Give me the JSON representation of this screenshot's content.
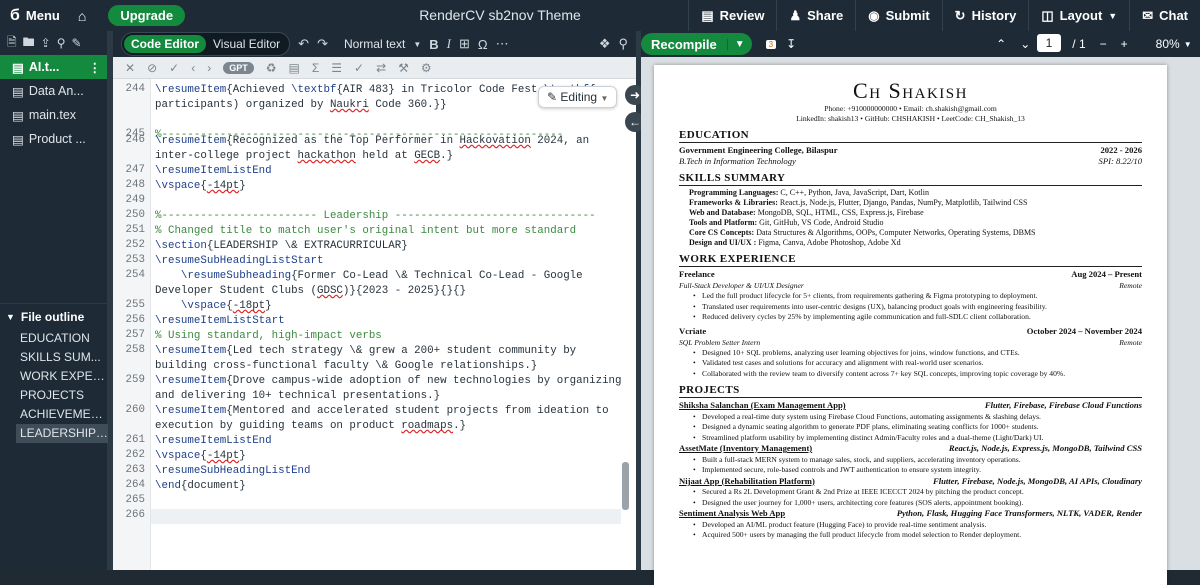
{
  "topbar": {
    "menu_label": "Menu",
    "upgrade_label": "Upgrade",
    "project_title": "RenderCV sb2nov Theme",
    "review_label": "Review",
    "share_label": "Share",
    "submit_label": "Submit",
    "history_label": "History",
    "layout_label": "Layout",
    "chat_label": "Chat"
  },
  "sidebar": {
    "files": [
      "AI.t...",
      "Data An...",
      "main.tex",
      "Product ..."
    ],
    "outline_title": "File outline",
    "outline": [
      "EDUCATION",
      "SKILLS SUM...",
      "WORK EXPER...",
      "PROJECTS",
      "ACHIEVEMEN...",
      "LEADERSHIP ..."
    ]
  },
  "editor": {
    "code_editor_label": "Code Editor",
    "visual_editor_label": "Visual Editor",
    "style_label": "Normal text",
    "gpt_label": "GPT",
    "editing_label": "Editing",
    "lines": [
      {
        "n": "244",
        "text": "\\resumeItem{Achieved \\textbf{AIR 483} in Tricolor Code Fest \\textbf{ participants) organized by Naukri Code 360.}}"
      },
      {
        "n": "245",
        "text": "%--------------------------------------------------------------"
      },
      {
        "n": "246",
        "text": "\\resumeItem{Recognized as the Top Performer in Hackovation 2024, an inter-college project hackathon held at GECB.}"
      },
      {
        "n": "247",
        "text": "\\resumeItemListEnd"
      },
      {
        "n": "248",
        "text": "\\vspace{-14pt}"
      },
      {
        "n": "249",
        "text": ""
      },
      {
        "n": "250",
        "text": "%------------------------ Leadership -------------------------------"
      },
      {
        "n": "251",
        "text": "% Changed title to match user's original intent but more standard"
      },
      {
        "n": "252",
        "text": "\\section{LEADERSHIP \\& EXTRACURRICULAR}"
      },
      {
        "n": "253",
        "text": "\\resumeSubHeadingListStart"
      },
      {
        "n": "254",
        "text": "    \\resumeSubheading{Former Co-Lead \\& Technical Co-Lead - Google Developer Student Clubs (GDSC)}{2023 - 2025}{}{}"
      },
      {
        "n": "255",
        "text": "    \\vspace{-18pt}"
      },
      {
        "n": "256",
        "text": "\\resumeItemListStart"
      },
      {
        "n": "257",
        "text": "% Using standard, high-impact verbs"
      },
      {
        "n": "258",
        "text": "\\resumeItem{Led tech strategy \\& grew a 200+ student community by building cross-functional faculty \\& Google relationships.}"
      },
      {
        "n": "259",
        "text": "\\resumeItem{Drove campus-wide adoption of new technologies by organizing and delivering 10+ technical presentations.}"
      },
      {
        "n": "260",
        "text": "\\resumeItem{Mentored and accelerated student projects from ideation to execution by guiding teams on product roadmaps.}"
      },
      {
        "n": "261",
        "text": "\\resumeItemListEnd"
      },
      {
        "n": "262",
        "text": "\\vspace{-14pt}"
      },
      {
        "n": "263",
        "text": "\\resumeSubHeadingListEnd"
      },
      {
        "n": "264",
        "text": "\\end{document}"
      },
      {
        "n": "265",
        "text": ""
      },
      {
        "n": "266",
        "text": ""
      }
    ]
  },
  "pdf": {
    "recompile_label": "Recompile",
    "page_current": "1",
    "page_total": "/ 1",
    "zoom": "80%",
    "name": "Ch Shakish",
    "contact1": "Phone: +910000000000 • Email: ch.shakish@gmail.com",
    "contact2": "LinkedIn: shakish13 • GitHub: CHSHAKISH • LeetCode: CH_Shakish_13",
    "education_title": "EDUCATION",
    "college": "Government Engineering College, Bilaspur",
    "college_dates": "2022 - 2026",
    "degree": "B.Tech in Information Technology",
    "spi": "SPI: 8.22/10",
    "skills_title": "SKILLS SUMMARY",
    "skills": [
      {
        "k": "Programming Languages:",
        "v": " C, C++, Python, Java, JavaScript, Dart, Kotlin"
      },
      {
        "k": "Frameworks & Libraries:",
        "v": " React.js, Node.js, Flutter, Django, Pandas, NumPy, Matplotlib, Tailwind CSS"
      },
      {
        "k": "Web and Database:",
        "v": " MongoDB, SQL, HTML, CSS, Express.js, Firebase"
      },
      {
        "k": "Tools and Platform:",
        "v": " Git, GitHub, VS Code, Android Studio"
      },
      {
        "k": "Core CS Concepts:",
        "v": " Data Structures & Algorithms, OOPs, Computer Networks, Operating Systems, DBMS"
      },
      {
        "k": "Design and UI/UX :",
        "v": " Figma, Canva, Adobe Photoshop, Adobe Xd"
      }
    ],
    "work_title": "WORK EXPERIENCE",
    "job1": "Freelance",
    "job1_dates": "Aug 2024 – Present",
    "job1_role": "Full-Stack Developer & UI/UX Designer",
    "job1_loc": "Remote",
    "job1_bullets": [
      "Led the full product lifecycle for 5+ clients, from requirements gathering & Figma prototyping to deployment.",
      "Translated user requirements into user-centric designs (UX), balancing product goals with engineering feasibility.",
      "Reduced delivery cycles by 25% by implementing agile communication and full-SDLC client collaboration."
    ],
    "job2": "Vcriate",
    "job2_dates": "October 2024 – November 2024",
    "job2_role": "SQL Problem Setter Intern",
    "job2_loc": "Remote",
    "job2_bullets": [
      "Designed 10+ SQL problems, analyzing user learning objectives for joins, window functions, and CTEs.",
      "Validated test cases and solutions for accuracy and alignment with real-world user scenarios.",
      "Collaborated with the review team to diversify content across 7+ key SQL concepts, improving topic coverage by 40%."
    ],
    "projects_title": "PROJECTS",
    "projects": [
      {
        "name": "Shiksha Salanchan (Exam Management App)",
        "tech": "Flutter, Firebase, Firebase Cloud Functions",
        "bullets": [
          "Developed a real-time duty system using Firebase Cloud Functions, automating assignments & slashing delays.",
          "Designed a dynamic seating algorithm to generate PDF plans, eliminating seating conflicts for 1000+ students.",
          "Streamlined platform usability by implementing distinct Admin/Faculty roles and a dual-theme (Light/Dark) UI."
        ]
      },
      {
        "name": "AssetMate (Inventory Management)",
        "tech": "React.js, Node.js, Express.js, MongoDB, Tailwind CSS",
        "bullets": [
          "Built a full-stack MERN system to manage sales, stock, and suppliers, accelerating inventory operations.",
          "Implemented secure, role-based controls and JWT authentication to ensure system integrity."
        ]
      },
      {
        "name": "Nijaat App (Rehabilitation Platform)",
        "tech": "Flutter, Firebase, Node.js, MongoDB, AI APIs, Cloudinary",
        "bullets": [
          "Secured a Rs 2L Development Grant & 2nd Prize at IEEE ICECCT 2024 by pitching the product concept.",
          "Designed the user journey for 1,000+ users, architecting core features (SOS alerts, appointment booking)."
        ]
      },
      {
        "name": "Sentiment Analysis Web App",
        "tech": "Python, Flask, Hugging Face Transformers, NLTK, VADER, Render",
        "bullets": [
          "Developed an AI/ML product feature (Hugging Face) to provide real-time sentiment analysis.",
          "Acquired 500+ users by managing the full product lifecycle from model selection to Render deployment."
        ]
      }
    ]
  }
}
